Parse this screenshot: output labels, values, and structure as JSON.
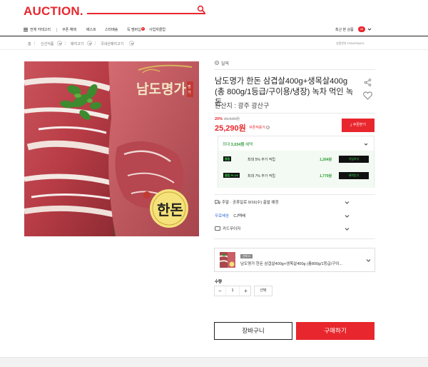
{
  "header": {
    "logo": "AUCTION.",
    "search_icon": "search-icon"
  },
  "gnb": {
    "all_categories": "전체 카테고리",
    "items": [
      "쿠폰·혜택",
      "베스트",
      "스타배송",
      "득 멤버십",
      "사업자클럽"
    ],
    "recent_label": "최근 본 상품",
    "recent_count": "46"
  },
  "breadcrumb": {
    "home": "홈",
    "items": [
      "신선식품",
      "돼지고기",
      "국내산돼지고기"
    ],
    "product_no": "상품번호 F3SAFN5A7L"
  },
  "product": {
    "deal_label": "딜픽",
    "title": "남도명가 한돈 삼겹살400g+생목살400g (총 800g/1등급/구이용/냉장) 녹차 먹인 녹돈",
    "origin": "원산지 : 광주 광산구",
    "discount_rate": "20%",
    "original_price": "31,630원",
    "price": "25,290원",
    "coupon_price_label": "쿠폰적용가",
    "coupon_button": "쿠폰받기",
    "image_brand_text": "남도명가",
    "image_badge_text": "한돈"
  },
  "benefits": {
    "summary_prefix": "최대",
    "summary_amount": "3,034원",
    "summary_suffix": "혜택",
    "rows": [
      {
        "logo": "클럽",
        "text": "최대 5% 추가 적립",
        "amount": "1,264원",
        "button": "가입하기"
      },
      {
        "logo": "클럽 PLUS",
        "text": "최대 7% 추가 적립",
        "amount": "1,770원",
        "button": "혜택받기"
      }
    ]
  },
  "delivery": {
    "schedule": "주말 · 공휴일로 9/16(수) 출발 예정",
    "free_label": "무료배송",
    "courier": "CJ택배",
    "card_label": "카드무이자"
  },
  "option": {
    "badge": "선택 01",
    "name": "남도명가 한돈 삼겹살400g+생목살400g (총800g/1등급/구이..."
  },
  "quantity": {
    "label": "수량",
    "minus": "−",
    "value": "1",
    "plus": "+",
    "select_button": "선택"
  },
  "actions": {
    "cart": "장바구니",
    "buy": "구매하기"
  },
  "colors": {
    "brand_red": "#e8262d",
    "benefit_green": "#2a9a35",
    "ship_blue": "#3b6fd6"
  }
}
